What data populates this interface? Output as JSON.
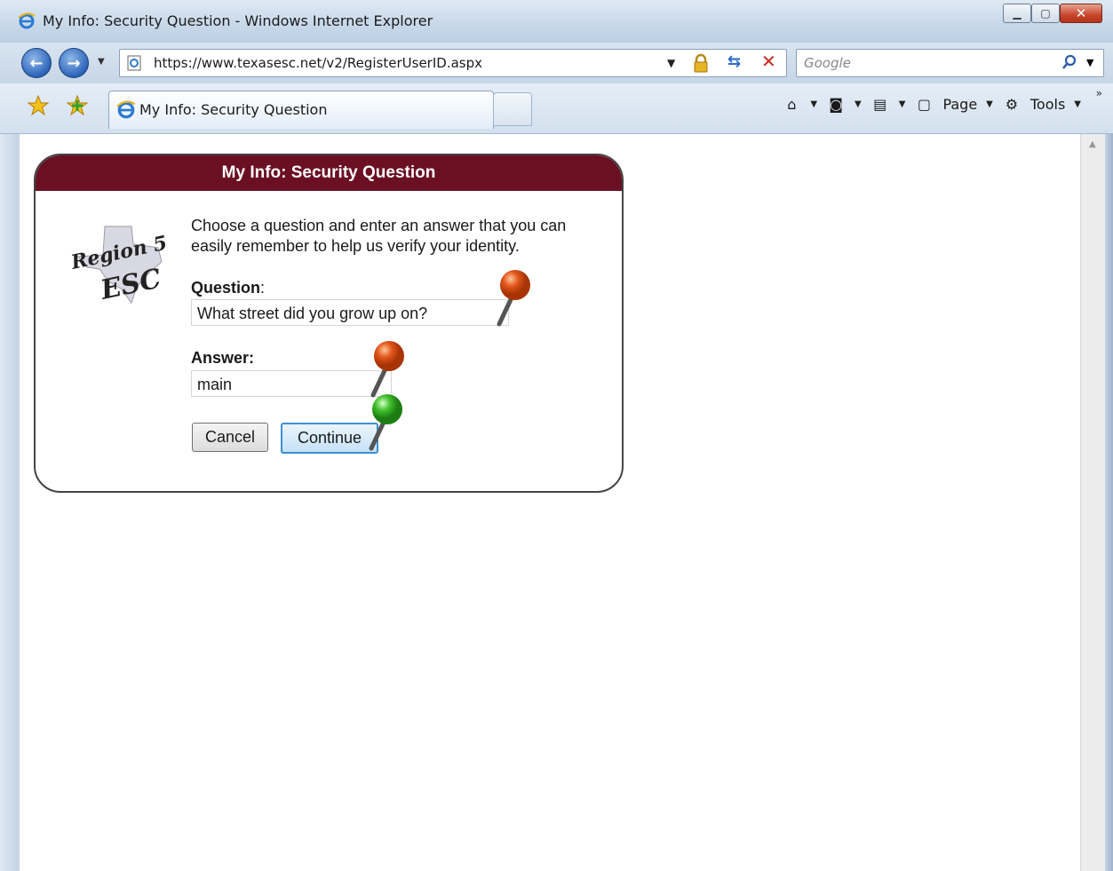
{
  "window": {
    "title": "My Info: Security Question - Windows Internet Explorer",
    "minimize_icon": "minimize-icon",
    "maximize_icon": "maximize-icon",
    "close_icon": "close-icon"
  },
  "address_bar": {
    "url": "https://www.texasesc.net/v2/RegisterUserID.aspx",
    "search_placeholder": "Google"
  },
  "tabs": [
    {
      "label": "My Info: Security Question",
      "active": true
    }
  ],
  "command_bar": {
    "page_label": "Page",
    "tools_label": "Tools"
  },
  "form": {
    "header": "My Info: Security Question",
    "logo_text": "Region 5 ESC",
    "intro": "Choose a question and enter an answer that you can easily remember to help us verify your identity.",
    "question_label": "Question",
    "question_colon": ":",
    "question_value": "What street did you grow up on?",
    "answer_label": "Answer:",
    "answer_value": "main",
    "cancel_label": "Cancel",
    "continue_label": "Continue"
  },
  "colors": {
    "header_bg": "#6b0f22",
    "pin_orange": "#e2561b",
    "pin_green": "#3fbf2c"
  }
}
